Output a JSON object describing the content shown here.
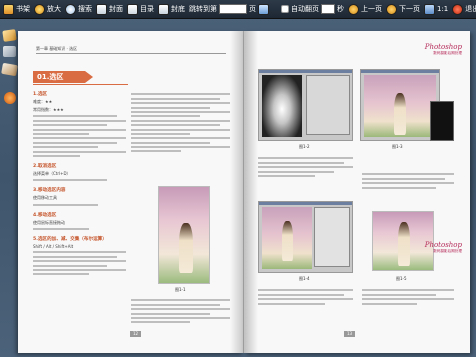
{
  "toolbar": {
    "bookshelf": "书架",
    "zoom_in": "放大",
    "search": "搜索",
    "front_cover": "封面",
    "toc": "目录",
    "back_cover": "封底",
    "jump_to": "跳转到第",
    "page_suffix": "页",
    "page_value": "",
    "auto_flip": "自动翻页",
    "seconds": "秒",
    "prev_page": "上一页",
    "next_page": "下一页",
    "ratio": "1:1",
    "exit": "退出"
  },
  "left_page": {
    "running_head": "第一章 基础知识 · 选区",
    "chapter_badge": "01.选区",
    "sections": [
      {
        "title": "1.选区",
        "meta": [
          "难度：★★",
          "常用指数：★★★"
        ]
      },
      {
        "title": "2.取消选区",
        "meta": [
          "选择菜单（Ctrl+D）"
        ]
      },
      {
        "title": "3.移动选区内容",
        "meta": [
          "使用移动工具"
        ]
      },
      {
        "title": "4.移动选区",
        "meta": [
          "使用鼠标直接拖动"
        ]
      },
      {
        "title": "5.选区的加、减、交集（布尔运算）",
        "meta": [
          "Shift / Alt / Shift+Alt"
        ]
      }
    ],
    "figure_caption": "图1-1",
    "page_number": "12"
  },
  "right_page": {
    "logo": "Photoshop",
    "logo_sub": "数码摄影后期处理",
    "figures": [
      "图1-2",
      "图1-3",
      "图1-4",
      "图1-5"
    ],
    "page_number": "13"
  }
}
